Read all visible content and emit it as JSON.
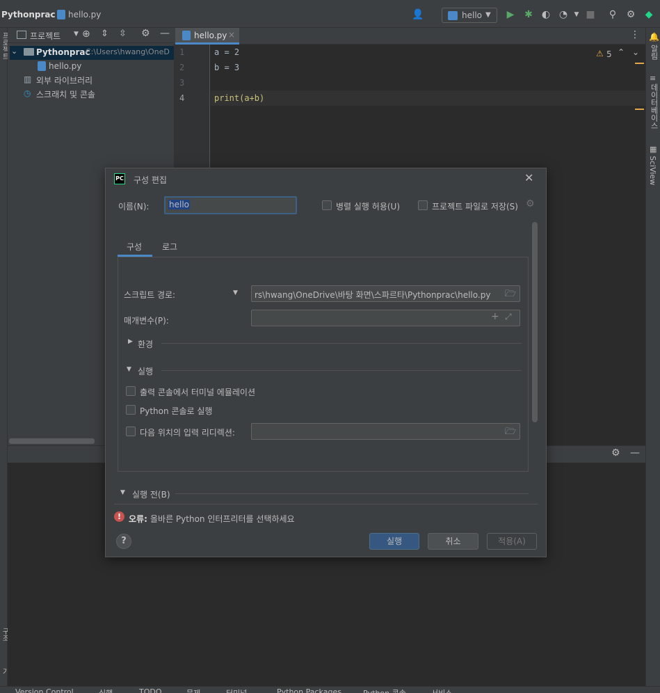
{
  "navbar": {
    "project": "Pythonprac",
    "file": "hello.py",
    "run_config": "hello"
  },
  "left_strip": {
    "label_top": "프로젝트",
    "label_mid": "구조",
    "label_bottom": "즐겨찾기"
  },
  "right_strip": {
    "notifications": "알림",
    "database": "데이터베이스",
    "sciview": "SciView"
  },
  "project_panel": {
    "title": "프로젝트",
    "root": "Pythonprac",
    "root_path": "C:\\Users\\hwang\\OneD",
    "file": "hello.py",
    "external_libs": "외부 라이브러리",
    "scratches": "스크래치 및 콘솔"
  },
  "editor": {
    "tab": "hello.py",
    "warnings": "5",
    "lines": [
      {
        "num": "1",
        "code": "a = 2"
      },
      {
        "num": "2",
        "code": "b = 3"
      },
      {
        "num": "3",
        "code": ""
      },
      {
        "num": "4",
        "code": "print(a+b)"
      }
    ]
  },
  "dialog": {
    "title": "구성 편집",
    "name_label": "이름(N):",
    "name_value": "hello",
    "parallel_label": "병렬 실행 허용(U)",
    "store_label": "프로젝트 파일로 저장(S)",
    "tabs": [
      "구성",
      "로그"
    ],
    "script_label": "스크립트 경로:",
    "script_value": "rs\\hwang\\OneDrive\\바탕 화면\\스파르타\\Pythonprac\\hello.py",
    "params_label": "매개변수(P):",
    "env_label": "환경",
    "exec_label": "실행",
    "emulate_label": "출력 콘솔에서 터미널 에뮬레이션",
    "python_console_label": "Python 콘솔로 실행",
    "redirect_label": "다음 위치의 입력 리디렉션:",
    "before_label": "실행 전(B)",
    "error_prefix": "오류:",
    "error_text": "올바른 Python 인터프리터를 선택하세요",
    "run_button": "실행",
    "cancel_button": "취소",
    "apply_button": "적용(A)",
    "help": "?"
  },
  "statusbar": {
    "items": [
      "Version Control",
      "실행",
      "TODO",
      "문제",
      "터미널",
      "Python Packages",
      "Python 콘솔",
      "서비스"
    ]
  },
  "colors": {
    "accent": "#4a88c7",
    "primary_button": "#365880",
    "error": "#c75450",
    "warning": "#e0a84a"
  }
}
